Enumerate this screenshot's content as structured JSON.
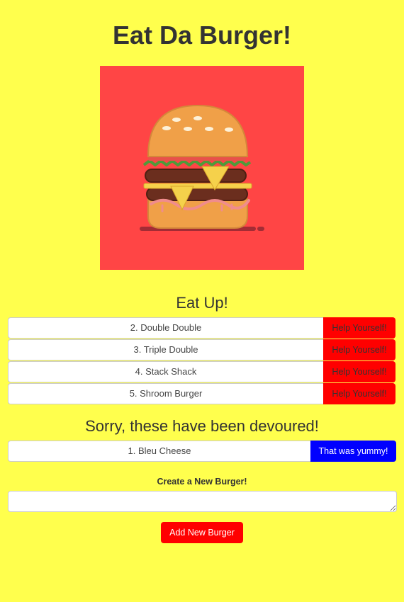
{
  "header": {
    "title": "Eat Da Burger!"
  },
  "hero": {
    "image": "burger-illustration",
    "background_color": "#FF4545"
  },
  "uneaten": {
    "heading": "Eat Up!",
    "items": [
      {
        "label": "2. Double Double",
        "button": "Help Yourself!"
      },
      {
        "label": "3. Triple Double",
        "button": "Help Yourself!"
      },
      {
        "label": "4. Stack Shack",
        "button": "Help Yourself!"
      },
      {
        "label": "5. Shroom Burger",
        "button": "Help Yourself!"
      }
    ],
    "button_color": "#FF0000"
  },
  "devoured": {
    "heading": "Sorry, these have been devoured!",
    "items": [
      {
        "label": "1. Bleu Cheese",
        "button": "That was yummy!"
      }
    ],
    "button_color": "#0000FF"
  },
  "form": {
    "label": "Create a New Burger!",
    "input_value": "",
    "submit_label": "Add New Burger"
  },
  "theme": {
    "background": "#FFFF4D",
    "accent": "#FF0000"
  }
}
